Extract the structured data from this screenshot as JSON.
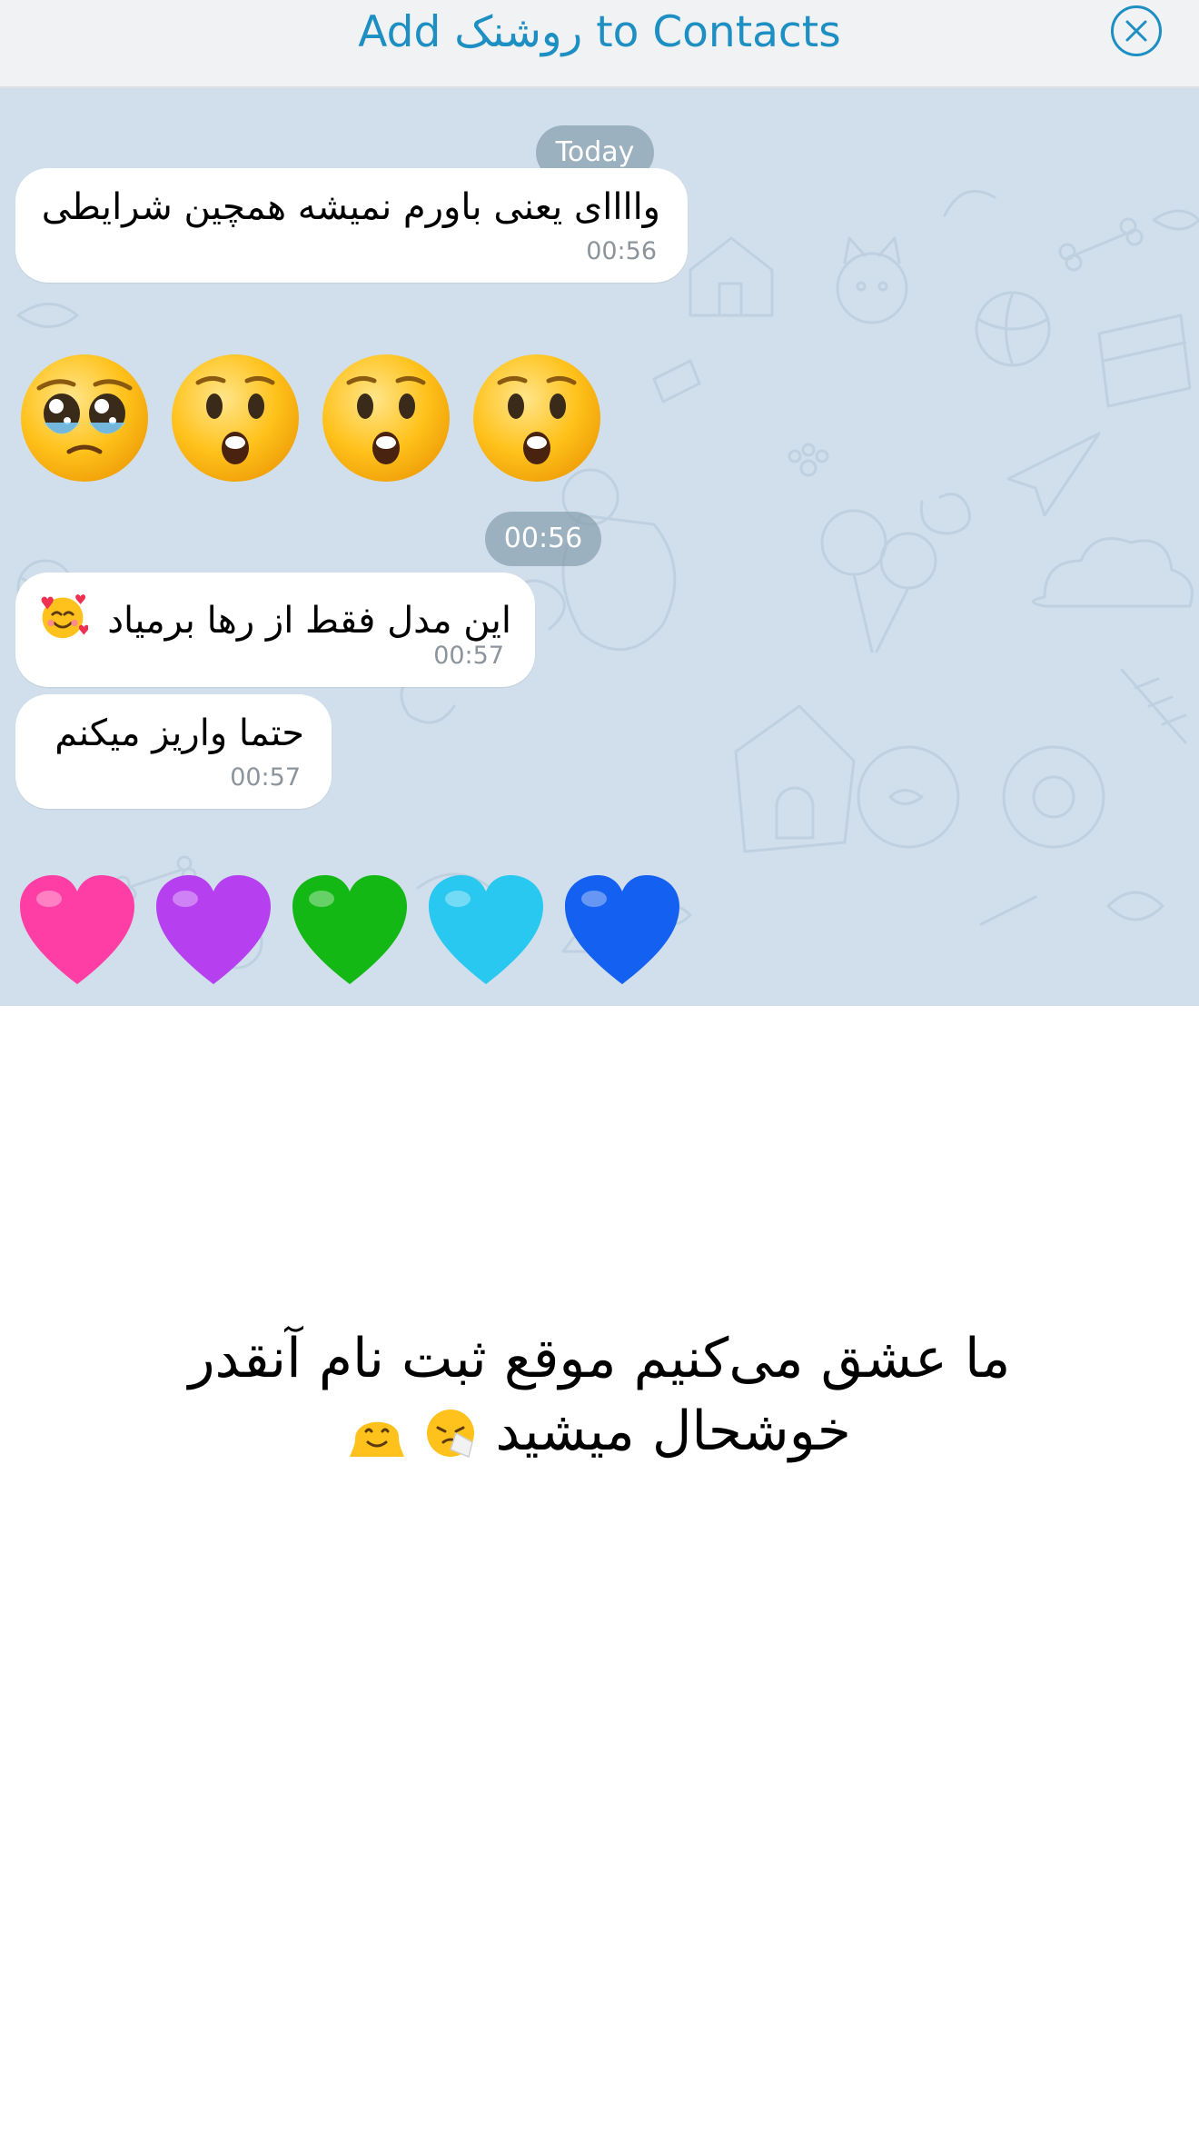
{
  "header": {
    "title": "Add روشنک to Contacts",
    "close_icon": "close-circle-icon",
    "accent_color": "#1d8fc3"
  },
  "chat": {
    "background_color": "#d0dfeb",
    "date_pill": "Today",
    "time_pill": "00:56",
    "messages": [
      {
        "text": "وااااى يعنى باورم نميشه همچين شرايطى",
        "time": "00:56"
      },
      {
        "text": "اين مدل فقط از رها برمياد",
        "time": "00:57",
        "trailing_emoji": "smiling-face-with-hearts"
      },
      {
        "text": "حتما واريز ميكنم",
        "time": "00:57"
      }
    ],
    "emoji_row_1": [
      "pleading-face",
      "hushed-face",
      "hushed-face",
      "hushed-face"
    ],
    "emoji_row_2": [
      {
        "name": "pink-heart",
        "color": "#ff3ea5"
      },
      {
        "name": "purple-heart",
        "color": "#b63ff0"
      },
      {
        "name": "green-heart",
        "color": "#14b814"
      },
      {
        "name": "light-blue-heart",
        "color": "#28c8f0"
      },
      {
        "name": "blue-heart",
        "color": "#1460f0"
      }
    ]
  },
  "caption": {
    "line1": "ما عشق می‌کنیم موقع ثبت نام آنقدر",
    "line2": "خوشحال میشید",
    "emojis": [
      "sneezing-face",
      "melting-face"
    ]
  }
}
